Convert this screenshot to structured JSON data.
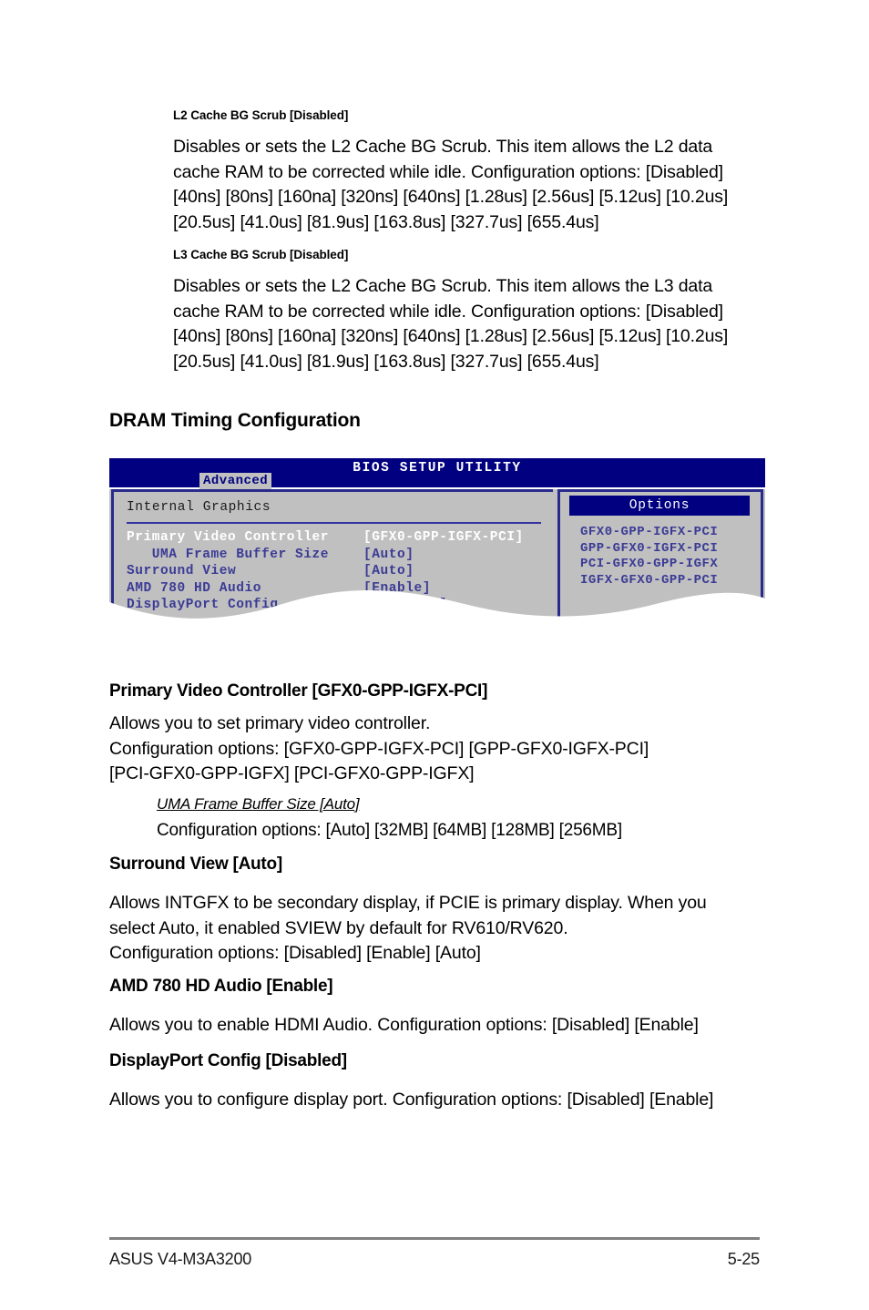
{
  "sections": {
    "l2": {
      "heading": "L2 Cache BG Scrub [Disabled]",
      "body": "Disables or sets the L2 Cache BG Scrub. This item allows the L2 data cache RAM to be corrected while idle. Configuration options: [Disabled] [40ns] [80ns] [160na] [320ns] [640ns] [1.28us] [2.56us] [5.12us] [10.2us] [20.5us] [41.0us] [81.9us] [163.8us] [327.7us] [655.4us]"
    },
    "l3": {
      "heading": "L3 Cache BG Scrub [Disabled]",
      "body": "Disables or sets the L2 Cache BG Scrub. This item allows the L3 data cache RAM to be corrected while idle. Configuration options: [Disabled] [40ns] [80ns] [160na] [320ns] [640ns] [1.28us] [2.56us] [5.12us] [10.2us] [20.5us] [41.0us] [81.9us] [163.8us] [327.7us] [655.4us]"
    },
    "dram_heading": "DRAM Timing Configuration",
    "primary_video": {
      "heading": "Primary Video Controller [GFX0-GPP-IGFX-PCI]",
      "body": "Allows you to set primary video controller.\nConfiguration options: [GFX0-GPP-IGFX-PCI] [GPP-GFX0-IGFX-PCI]\n[PCI-GFX0-GPP-IGFX] [PCI-GFX0-GPP-IGFX]"
    },
    "uma": {
      "heading": "UMA Frame Buffer Size [Auto]",
      "body": "Configuration options: [Auto] [32MB] [64MB] [128MB] [256MB]"
    },
    "surround_view": {
      "heading": "Surround View [Auto]",
      "body": "Allows INTGFX to be secondary display, if PCIE is primary display. When you select Auto, it enabled SVIEW by default for RV610/RV620.\nConfiguration options: [Disabled] [Enable] [Auto]"
    },
    "hd_audio": {
      "heading": "AMD 780 HD Audio [Enable]",
      "body": "Allows you to enable HDMI Audio. Configuration options: [Disabled] [Enable]"
    },
    "displayport": {
      "heading": "DisplayPort Config [Disabled]",
      "body": "Allows you to configure display port. Configuration options: [Disabled] [Enable]"
    }
  },
  "bios": {
    "title": "BIOS SETUP UTILITY",
    "active_tab": "Advanced",
    "panel_heading": "Internal Graphics",
    "menu": [
      {
        "label": "Primary Video Controller",
        "value": "[GFX0-GPP-IGFX-PCI]",
        "selected": true,
        "indent": 0
      },
      {
        "label": "UMA Frame Buffer Size",
        "value": "[Auto]",
        "selected": false,
        "indent": 1
      },
      {
        "label": "Surround View",
        "value": "[Auto]",
        "selected": false,
        "indent": 0
      },
      {
        "label": "AMD 780 HD Audio",
        "value": "[Enable]",
        "selected": false,
        "indent": 0
      },
      {
        "label": "DisplayPort Config",
        "value": "[Disabled]",
        "selected": false,
        "indent": 0
      }
    ],
    "options_title": "Options",
    "options": [
      "GFX0-GPP-IGFX-PCI",
      "GPP-GFX0-IGFX-PCI",
      "PCI-GFX0-GPP-IGFX",
      "IGFX-GFX0-GPP-PCI"
    ],
    "colors": {
      "header_blue": "#000080",
      "panel_gray": "#c0c0c0",
      "text_blue": "#3b3b96",
      "selected_white": "#ffffff",
      "border_blue": "#2a2a8c"
    }
  },
  "footer": {
    "left": "ASUS V4-M3A3200",
    "right": "5-25"
  }
}
